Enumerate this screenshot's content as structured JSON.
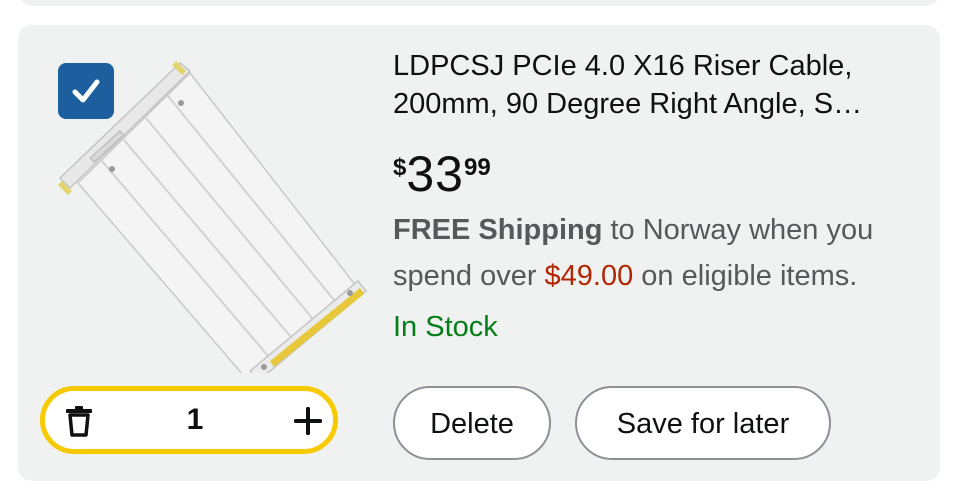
{
  "product": {
    "title_line1": "LDPCSJ PCIe 4.0 X16 Riser Cable,",
    "title_line2": "200mm, 90 Degree Right Angle, S…",
    "price": {
      "symbol": "$",
      "whole": "33",
      "fraction": "99"
    },
    "shipping": {
      "bold": "FREE Shipping",
      "text1": " to Norway when you",
      "text2": "spend over ",
      "amount": "$49.00",
      "text3": " on eligible items."
    },
    "stock": "In Stock",
    "selected": true
  },
  "stepper": {
    "quantity": "1"
  },
  "actions": {
    "delete_label": "Delete",
    "save_label": "Save for later"
  },
  "colors": {
    "accent_yellow": "#f7ca00",
    "checkbox_blue": "#1d5f9e",
    "price_red": "#b12704",
    "stock_green": "#067d17",
    "card_bg": "#f0f2f2"
  },
  "icons": {
    "checkbox": "checkmark-icon",
    "stepper_left": "trash-icon",
    "stepper_right": "plus-icon"
  }
}
